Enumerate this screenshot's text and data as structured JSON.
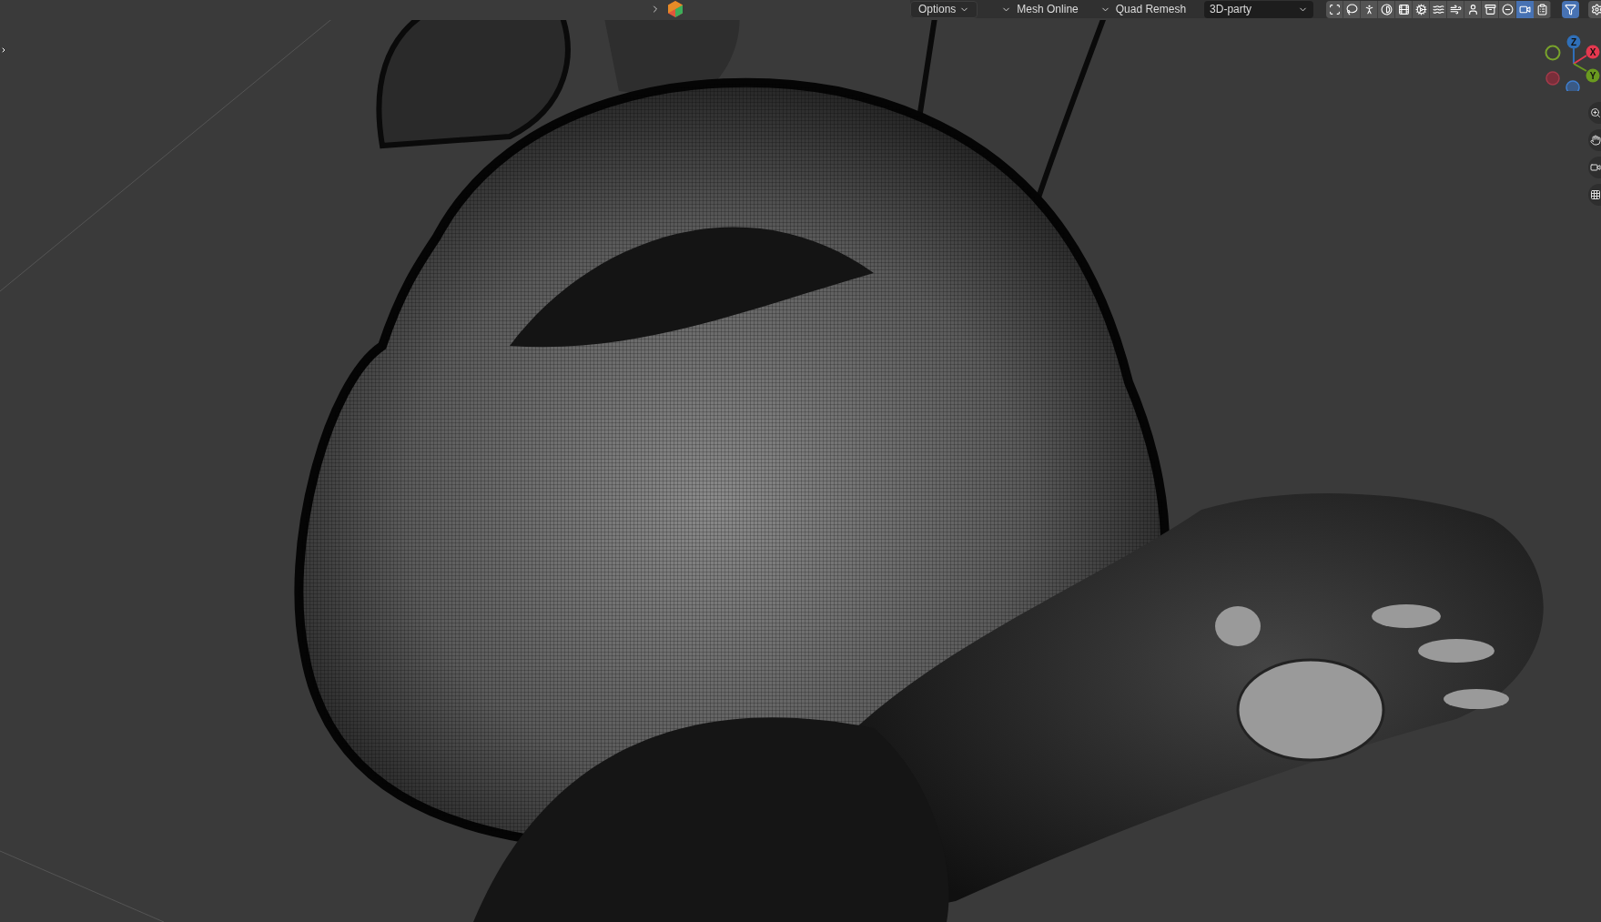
{
  "header": {
    "menus": [
      {
        "label": "Options",
        "kind": "button"
      },
      {
        "label": "Mesh Online",
        "kind": "collapsible"
      },
      {
        "label": "Quad Remesh",
        "kind": "collapsible"
      }
    ],
    "addon_dropdown": {
      "value": "3D-party"
    },
    "toolbar": [
      {
        "selected": false
      },
      {
        "selected": false
      },
      {
        "selected": false
      },
      {
        "selected": false
      },
      {
        "selected": false
      },
      {
        "selected": false
      },
      {
        "selected": false
      },
      {
        "selected": false
      },
      {
        "selected": false
      },
      {
        "selected": false
      },
      {
        "selected": false
      },
      {
        "selected": true
      },
      {
        "selected": false
      }
    ],
    "filter": {
      "selected": true
    }
  },
  "gizmo": {
    "axes": [
      {
        "label": "X",
        "color": "#e5384f"
      },
      {
        "label": "Y",
        "color": "#6a9a1f"
      },
      {
        "label": "Z",
        "color": "#2f6fb8"
      }
    ]
  }
}
